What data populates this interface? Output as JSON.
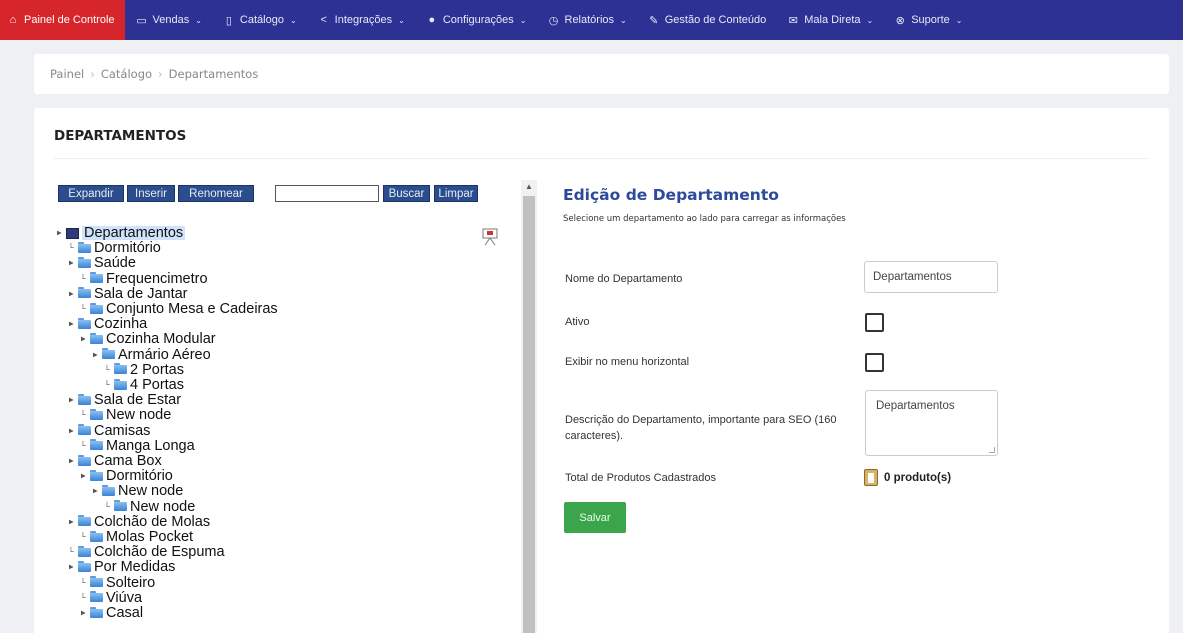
{
  "nav": {
    "items": [
      {
        "label": "Painel de Controle",
        "icon": "home-icon",
        "active": true,
        "caret": false
      },
      {
        "label": "Vendas",
        "icon": "card-icon",
        "caret": true
      },
      {
        "label": "Catálogo",
        "icon": "book-icon",
        "caret": true
      },
      {
        "label": "Integrações",
        "icon": "share-icon",
        "caret": true
      },
      {
        "label": "Configurações",
        "icon": "gear-icon",
        "caret": true
      },
      {
        "label": "Relatórios",
        "icon": "chart-icon",
        "caret": true
      },
      {
        "label": "Gestão de Conteúdo",
        "icon": "edit-icon",
        "caret": false
      },
      {
        "label": "Mala Direta",
        "icon": "mail-icon",
        "caret": true
      },
      {
        "label": "Suporte",
        "icon": "support-icon",
        "caret": true
      }
    ]
  },
  "breadcrumb": [
    "Painel",
    "Catálogo",
    "Departamentos"
  ],
  "page_title": "DEPARTAMENTOS",
  "toolbar": {
    "expandir": "Expandir",
    "inserir": "Inserir",
    "renomear": "Renomear",
    "search_value": "",
    "buscar": "Buscar",
    "limpar": "Limpar"
  },
  "tree": [
    {
      "label": "Departamentos",
      "level": 0,
      "expander": "+",
      "root": true
    },
    {
      "label": "Dormitório",
      "level": 1,
      "expander": ""
    },
    {
      "label": "Saúde",
      "level": 1,
      "expander": "+"
    },
    {
      "label": "Frequencimetro",
      "level": 2,
      "expander": ""
    },
    {
      "label": "Sala de Jantar",
      "level": 1,
      "expander": "+"
    },
    {
      "label": "Conjunto Mesa e Cadeiras",
      "level": 2,
      "expander": ""
    },
    {
      "label": "Cozinha",
      "level": 1,
      "expander": "+"
    },
    {
      "label": "Cozinha Modular",
      "level": 2,
      "expander": "+"
    },
    {
      "label": "Armário Aéreo",
      "level": 3,
      "expander": "+"
    },
    {
      "label": "2 Portas",
      "level": 4,
      "expander": ""
    },
    {
      "label": "4 Portas",
      "level": 4,
      "expander": ""
    },
    {
      "label": "Sala de Estar",
      "level": 1,
      "expander": "+"
    },
    {
      "label": "New node",
      "level": 2,
      "expander": ""
    },
    {
      "label": "Camisas",
      "level": 1,
      "expander": "+"
    },
    {
      "label": "Manga Longa",
      "level": 2,
      "expander": ""
    },
    {
      "label": "Cama Box",
      "level": 1,
      "expander": "+"
    },
    {
      "label": "Dormitório",
      "level": 2,
      "expander": "+"
    },
    {
      "label": "New node",
      "level": 3,
      "expander": "+"
    },
    {
      "label": "New node",
      "level": 4,
      "expander": ""
    },
    {
      "label": "Colchão de Molas",
      "level": 1,
      "expander": "+"
    },
    {
      "label": "Molas Pocket",
      "level": 2,
      "expander": ""
    },
    {
      "label": "Colchão de Espuma",
      "level": 1,
      "expander": ""
    },
    {
      "label": "Por Medidas",
      "level": 1,
      "expander": "+"
    },
    {
      "label": "Solteiro",
      "level": 2,
      "expander": ""
    },
    {
      "label": "Viúva",
      "level": 2,
      "expander": ""
    },
    {
      "label": "Casal",
      "level": 2,
      "expander": "+"
    }
  ],
  "form": {
    "title": "Edição de Departamento",
    "subtitle": "Selecione um departamento ao lado para carregar as informações",
    "nome_label": "Nome do Departamento",
    "nome_value": "Departamentos",
    "ativo_label": "Ativo",
    "ativo_checked": false,
    "menu_label": "Exibir no menu horizontal",
    "menu_checked": false,
    "descricao_label": "Descrição do Departamento, importante para SEO (160 caracteres).",
    "descricao_value": "Departamentos",
    "total_label": "Total de Produtos Cadastrados",
    "total_value": "0 produto(s)",
    "salvar": "Salvar"
  },
  "colors": {
    "nav_bg": "#2d3193",
    "nav_active": "#d7262b",
    "toolbar_btn": "#2b4d8c",
    "form_title": "#2c4a9a",
    "save_btn": "#3aa54a"
  }
}
